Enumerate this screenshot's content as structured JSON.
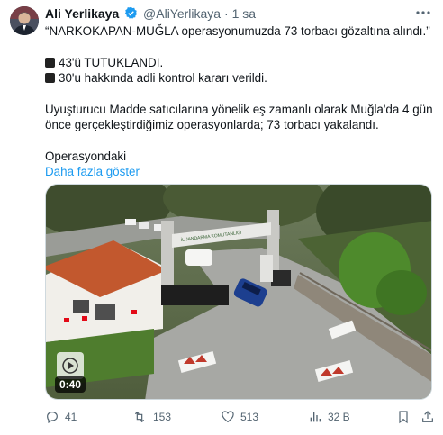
{
  "tweet": {
    "author_name": "Ali Yerlikaya",
    "handle": "@AliYerlikaya",
    "separator": "·",
    "time": "1 sa",
    "lines": [
      "“NARKOKAPAN-MUĞLA operasyonumuzda 73 torbacı gözaltına alındı.”",
      "43'ü TUTUKLANDI.",
      "30'u hakkında adli kontrol kararı verildi.",
      "Uyuşturucu Madde satıcılarına yönelik eş zamanlı olarak Muğla'da 4 gün",
      "önce gerçekleştirdiğimiz operasyonlarda; 73 torbacı yakalandı.",
      "Operasyondaki"
    ],
    "show_more": "Daha fazla göster"
  },
  "media": {
    "duration": "0:40",
    "gate_sign": "İL JANDARMA KOMUTANLIĞI"
  },
  "actions": {
    "replies": "41",
    "retweets": "153",
    "likes": "513",
    "views": "32 B"
  },
  "colors": {
    "link": "#1d9bf0",
    "secondary_text": "#536471",
    "verified": "#1d9bf0"
  }
}
